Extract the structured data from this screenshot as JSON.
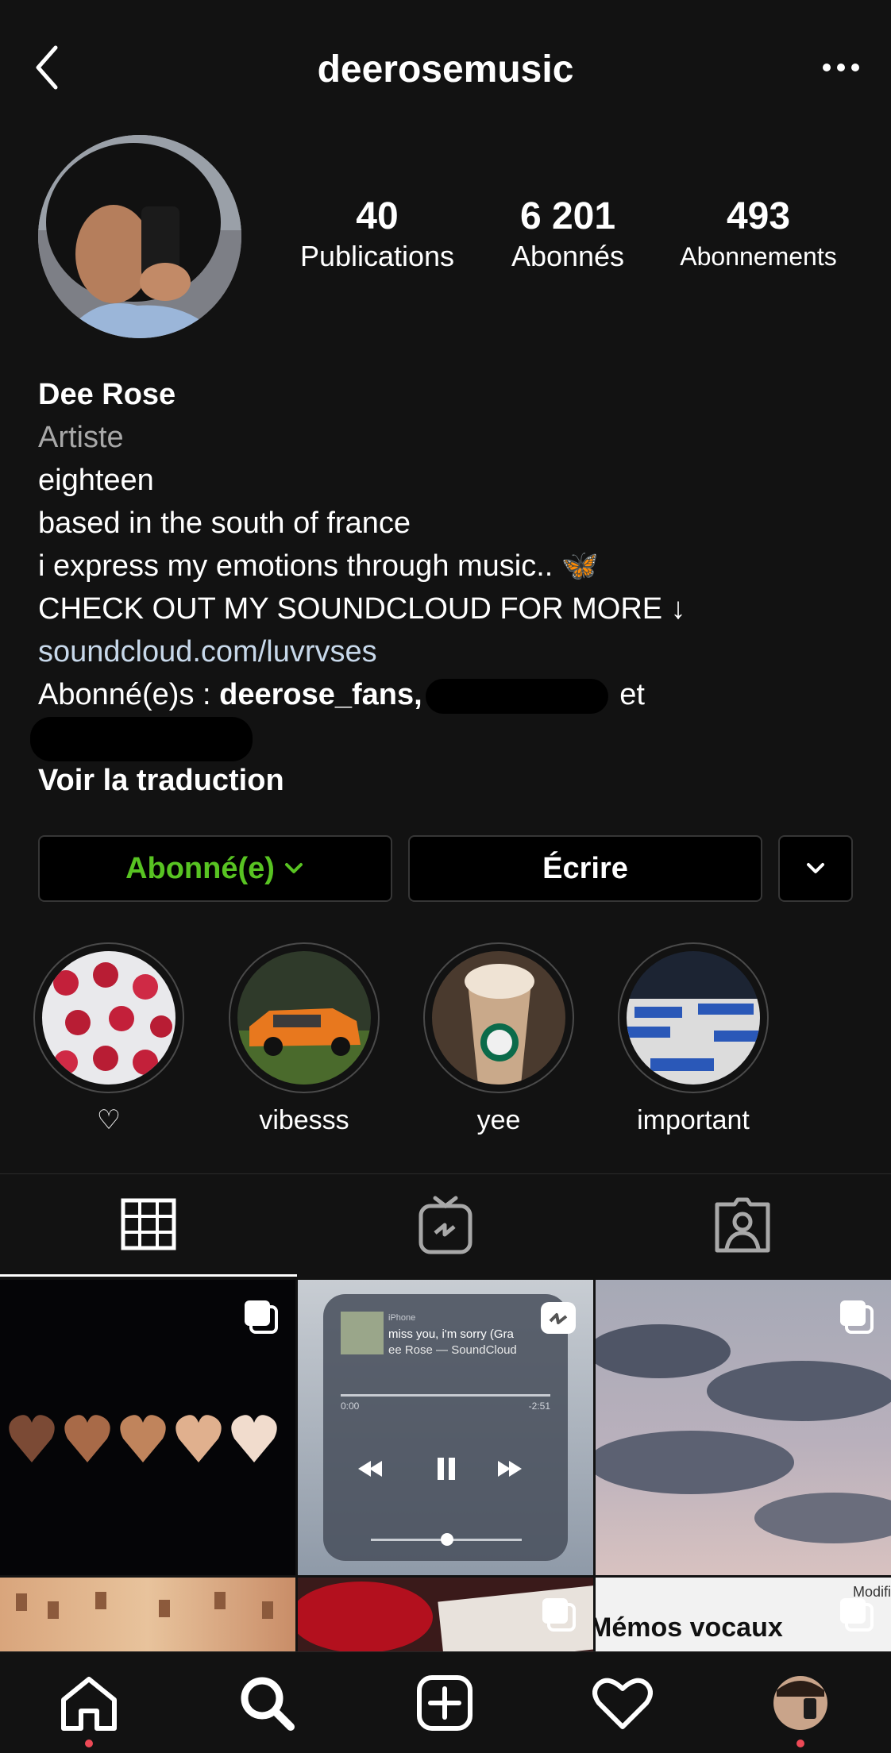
{
  "header": {
    "username": "deerosemusic"
  },
  "stats": [
    {
      "value": "40",
      "label": "Publications"
    },
    {
      "value": "6 201",
      "label": "Abonnés"
    },
    {
      "value": "493",
      "label": "Abonnements"
    }
  ],
  "bio": {
    "name": "Dee Rose",
    "category": "Artiste",
    "lines": [
      "eighteen",
      "based in the south of france",
      "i express my emotions through music.. 🦋",
      "CHECK OUT MY SOUNDCLOUD FOR MORE ↓"
    ],
    "link": "soundcloud.com/luvrvses",
    "followed_by_prefix": "Abonné(e)s : ",
    "followed_by_user": "deerose_fans,",
    "followed_by_suffix": " et",
    "translate": "Voir la traduction"
  },
  "buttons": {
    "follow": "Abonné(e)",
    "message": "Écrire"
  },
  "highlights": [
    {
      "label": "♡"
    },
    {
      "label": "vibesss"
    },
    {
      "label": "yee"
    },
    {
      "label": "important"
    }
  ],
  "posts": {
    "player_source": "iPhone",
    "player_title": "miss you, i'm sorry (Gra",
    "player_artist": "ee Rose — SoundCloud",
    "player_time_start": "0:00",
    "player_time_end": "-2:51",
    "memo_title": "Mémos vocaux",
    "memo_edit": "Modifi"
  },
  "colors": {
    "background": "#121212",
    "follow_green": "#58c322",
    "link": "#c7d8ea",
    "notification_dot": "#ed4956"
  },
  "icons": [
    "back-icon",
    "more-icon",
    "chevron-down-icon",
    "grid-icon",
    "igtv-icon",
    "tagged-icon",
    "home-icon",
    "search-icon",
    "add-icon",
    "heart-icon"
  ]
}
